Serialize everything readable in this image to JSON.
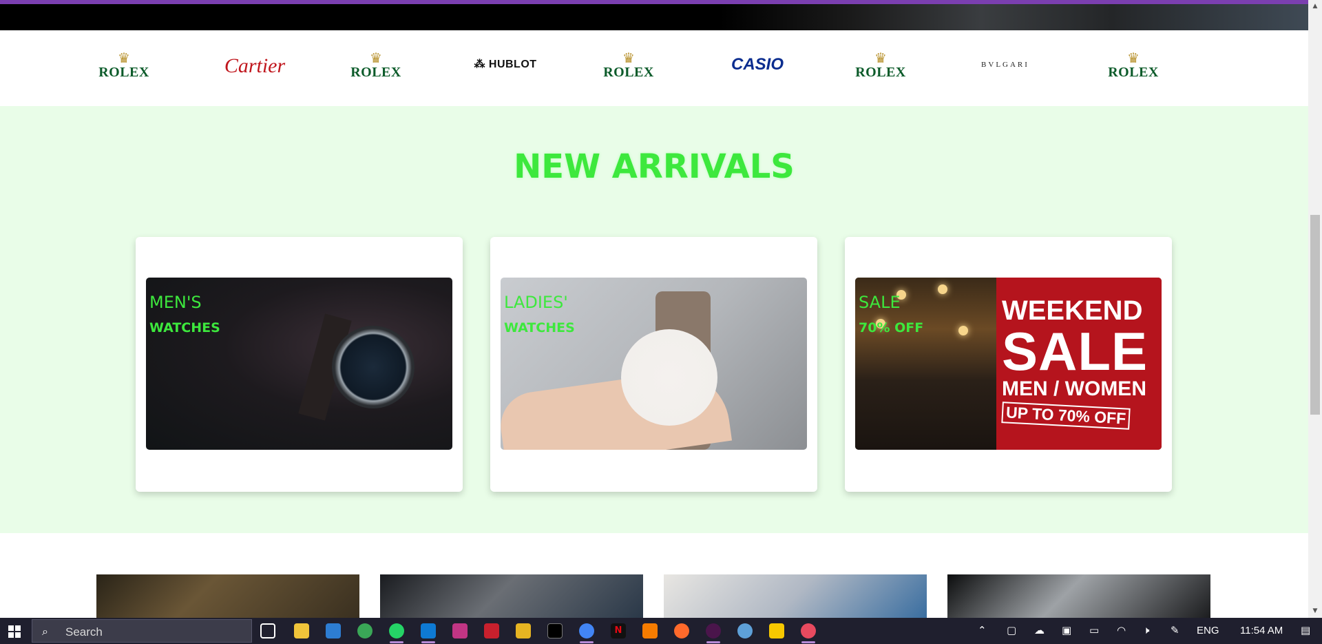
{
  "brands": {
    "items": [
      {
        "type": "rolex",
        "name": "ROLEX"
      },
      {
        "type": "cartier",
        "name": "Cartier"
      },
      {
        "type": "rolex",
        "name": "ROLEX"
      },
      {
        "type": "hublot",
        "name": "⁂ HUBLOT"
      },
      {
        "type": "rolex",
        "name": "ROLEX"
      },
      {
        "type": "casio",
        "name": "CASIO"
      },
      {
        "type": "rolex",
        "name": "ROLEX"
      },
      {
        "type": "bvlgari",
        "name": "BVLGARI"
      },
      {
        "type": "rolex",
        "name": "ROLEX"
      }
    ]
  },
  "arrivals": {
    "title": "NEW ARRIVALS",
    "cards": [
      {
        "title": "MEN'S",
        "subtitle": "WATCHES"
      },
      {
        "title": "LADIES'",
        "subtitle": "WATCHES"
      },
      {
        "title": "SALE",
        "subtitle": "70% OFF"
      }
    ],
    "sale_sign": {
      "line1": "WEEKEND",
      "line2": "SALE",
      "line3": "MEN / WOMEN",
      "line4": "UP TO 70% OFF"
    }
  },
  "taskbar": {
    "search_placeholder": "Search",
    "language": "ENG",
    "time": "11:54 AM"
  },
  "colors": {
    "accent_green": "#3de83d",
    "section_bg": "#e9fde8",
    "top_accent": "#7b3fb0"
  }
}
